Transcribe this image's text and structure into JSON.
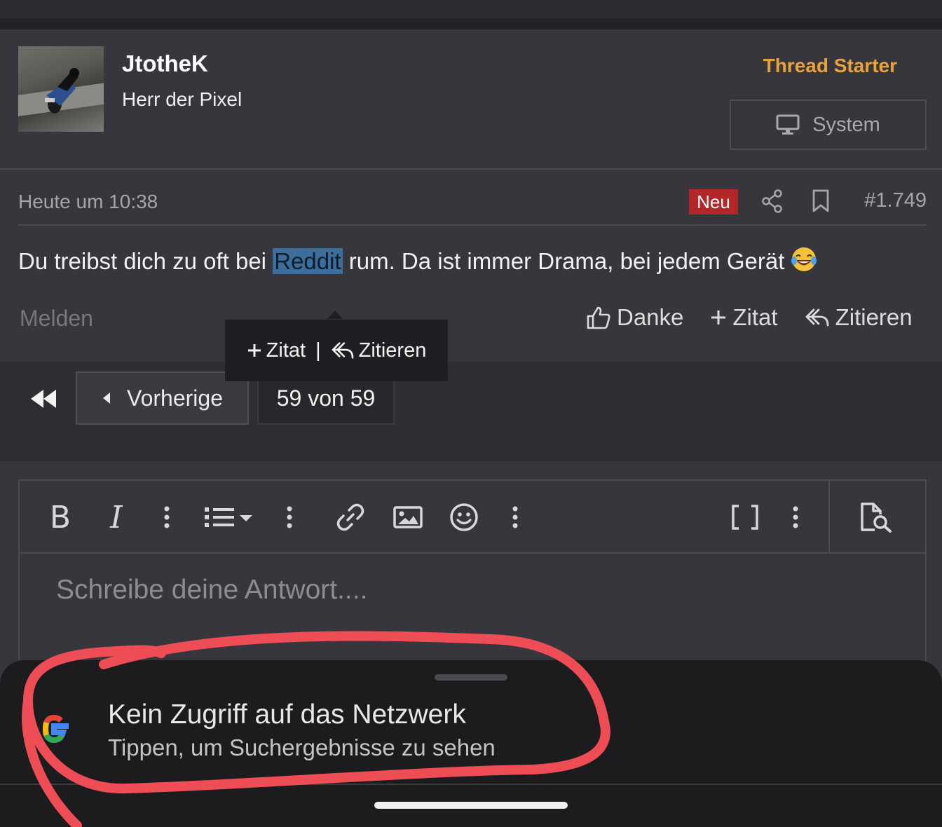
{
  "post": {
    "username": "JtotheK",
    "user_title": "Herr der Pixel",
    "thread_starter": "Thread Starter",
    "system_label": "System",
    "date": "Heute um 10:38",
    "badge": "Neu",
    "post_number": "#1.749",
    "message_before": "Du treibst dich zu oft bei ",
    "message_highlight": "Reddit",
    "message_after": " rum. Da ist immer Drama, bei jedem Gerät",
    "report": "Melden",
    "thanks": "Danke",
    "quote_add": "Zitat",
    "quote": "Zitieren"
  },
  "selection_popup": {
    "add_quote": "Zitat",
    "separator": "|",
    "quote": "Zitieren"
  },
  "pagination": {
    "prev": "Vorherige",
    "page": "59 von 59"
  },
  "editor": {
    "placeholder": "Schreibe deine Antwort...."
  },
  "snackbar": {
    "title": "Kein Zugriff auf das Netzwerk",
    "subtitle": "Tippen, um Suchergebnisse zu sehen"
  },
  "colors": {
    "accent": "#e8a33c",
    "badge": "#b32727",
    "highlight": "#3d6d9a",
    "annotation": "#ef4d56"
  },
  "icons": [
    "monitor-icon",
    "share-icon",
    "bookmark-icon",
    "laughing-emoji",
    "thumbs-up-icon",
    "plus-icon",
    "reply-icon",
    "rewind-icon",
    "caret-left-icon",
    "bold-icon",
    "italic-icon",
    "more-icon",
    "list-icon",
    "link-icon",
    "image-icon",
    "smiley-icon",
    "brackets-icon",
    "preview-icon",
    "google-logo"
  ]
}
